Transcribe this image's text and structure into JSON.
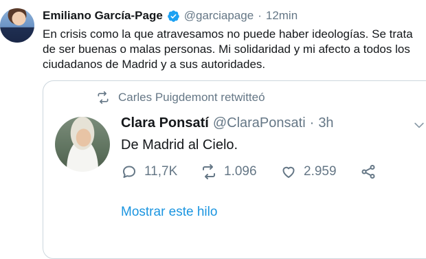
{
  "tweet": {
    "author_name": "Emiliano García-Page",
    "author_handle": "@garciapage",
    "separator": "·",
    "time": "12min",
    "text": "En crisis como la que atravesamos no puede haber ideologías. Se trata de ser buenas o malas personas. Mi solidaridad y mi afecto a todos los ciudadanos de Madrid y a sus autoridades."
  },
  "quoted": {
    "retweeted_by": "Carles Puigdemont retwitteó",
    "author_name": "Clara Ponsatí",
    "author_handle": "@ClaraPonsati",
    "separator": "·",
    "time": "3h",
    "text": "De Madrid al Cielo.",
    "replies": "11,7K",
    "retweets": "1.096",
    "likes": "2.959",
    "show_thread": "Mostrar este hilo"
  },
  "colors": {
    "link": "#1b95e0",
    "verified": "#1da1f2",
    "muted": "#657786",
    "border": "#ccd6dd"
  }
}
